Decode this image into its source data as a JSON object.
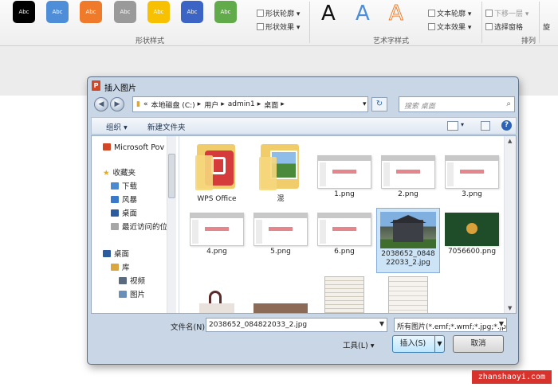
{
  "ribbon": {
    "swatches": [
      {
        "label": "Abc",
        "color": "#000000"
      },
      {
        "label": "Abc",
        "color": "#4e8ed8"
      },
      {
        "label": "Abc",
        "color": "#ef7b2a"
      },
      {
        "label": "Abc",
        "color": "#9a9a9a"
      },
      {
        "label": "Abc",
        "color": "#f7c000"
      },
      {
        "label": "Abc",
        "color": "#3b64c4"
      },
      {
        "label": "Abc",
        "color": "#62ab4a"
      }
    ],
    "shape_outline": "形状轮廓",
    "shape_effect": "形状效果",
    "shape_group_label": "形状样式",
    "art_letters": [
      "A",
      "A",
      "A"
    ],
    "text_outline": "文本轮廓",
    "text_effect": "文本效果",
    "art_group_label": "艺术字样式",
    "move_back": "下移一层",
    "selection_pane": "选择窗格",
    "arrange_label": "排列",
    "rotate": "旋"
  },
  "dialog": {
    "title": "插入图片",
    "address_prefix": "«",
    "address_parts": [
      "本地磁盘 (C:)",
      "用户",
      "admin1",
      "桌面"
    ],
    "search_placeholder": "搜索 桌面",
    "toolbar": {
      "organize": "组织",
      "new_folder": "新建文件夹"
    },
    "nav_items": [
      {
        "label": "Microsoft Pov",
        "icon": "powerpoint-icon"
      },
      {
        "label": "收藏夹",
        "icon": "star-icon"
      },
      {
        "label": "下载",
        "icon": "download-folder-icon"
      },
      {
        "label": "风暴",
        "icon": "folder-icon"
      },
      {
        "label": "桌面",
        "icon": "desktop-icon"
      },
      {
        "label": "最近访问的位",
        "icon": "recent-icon"
      },
      {
        "label": "桌面",
        "icon": "desktop-icon"
      },
      {
        "label": "库",
        "icon": "library-icon"
      },
      {
        "label": "视频",
        "icon": "video-icon"
      },
      {
        "label": "图片",
        "icon": "picture-icon"
      }
    ],
    "files": [
      {
        "name": "WPS Office",
        "kind": "folder-wps"
      },
      {
        "name": "混",
        "kind": "folder-photo"
      },
      {
        "name": "1.png",
        "kind": "slide"
      },
      {
        "name": "2.png",
        "kind": "slide"
      },
      {
        "name": "3.png",
        "kind": "slide"
      },
      {
        "name": "4.png",
        "kind": "slide"
      },
      {
        "name": "5.png",
        "kind": "slide"
      },
      {
        "name": "6.png",
        "kind": "slide"
      },
      {
        "name": "2038652_084822033_2.jpg",
        "kind": "house"
      },
      {
        "name": "7056600.png",
        "kind": "green"
      },
      {
        "name": "",
        "kind": "partial"
      },
      {
        "name": "",
        "kind": "partial"
      },
      {
        "name": "",
        "kind": "partial"
      },
      {
        "name": "",
        "kind": "partial"
      }
    ],
    "filename_label": "文件名(N):",
    "filename_value": "2038652_084822033_2.jpg",
    "filter_value": "所有图片(*.emf;*.wmf;*.jpg;*.jp",
    "tools_label": "工具(L)",
    "insert_label": "插入(S)",
    "cancel_label": "取消"
  },
  "watermark": "zhanshaoyi.com"
}
